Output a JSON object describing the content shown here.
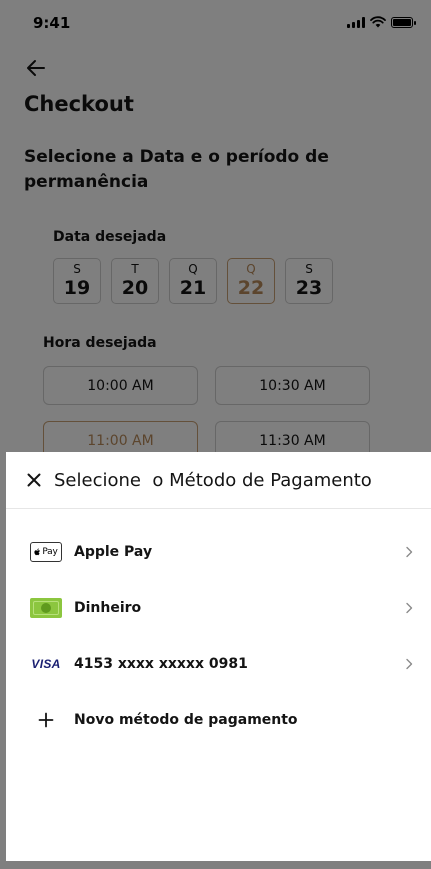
{
  "status_bar": {
    "time": "9:41"
  },
  "checkout": {
    "title": "Checkout",
    "section_title": "Selecione a Data e o período de permanência",
    "date_label": "Data desejada",
    "dates": [
      {
        "dow": "S",
        "day": "19",
        "selected": false
      },
      {
        "dow": "T",
        "day": "20",
        "selected": false
      },
      {
        "dow": "Q",
        "day": "21",
        "selected": false
      },
      {
        "dow": "Q",
        "day": "22",
        "selected": true
      },
      {
        "dow": "S",
        "day": "23",
        "selected": false
      }
    ],
    "time_label": "Hora desejada",
    "times": [
      {
        "label": "10:00 AM",
        "selected": false
      },
      {
        "label": "10:30 AM",
        "selected": false
      },
      {
        "label": "11:00 AM",
        "selected": true
      },
      {
        "label": "11:30 AM",
        "selected": false
      }
    ]
  },
  "payment_sheet": {
    "title": "Selecione  o Método de Pagamento",
    "methods": [
      {
        "icon": "apple-pay-icon",
        "icon_text": "Pay",
        "label": "Apple Pay"
      },
      {
        "icon": "cash-icon",
        "label": "Dinheiro"
      },
      {
        "icon": "visa-icon",
        "icon_text": "VISA",
        "label": "4153 xxxx xxxxx 0981"
      },
      {
        "icon": "plus-icon",
        "label": "Novo método de pagamento"
      }
    ]
  },
  "colors": {
    "accent": "#c9a074",
    "overlay": "rgba(0,0,0,0.5)",
    "cash_green": "#8cc63f",
    "visa_blue": "#1a1f71"
  }
}
